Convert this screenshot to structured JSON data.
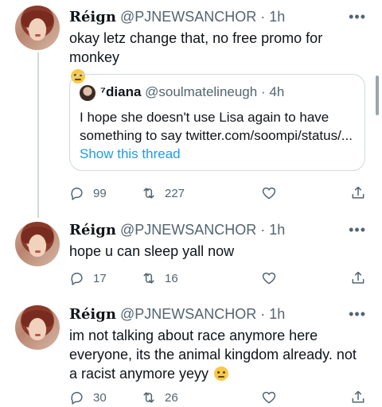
{
  "tweets": [
    {
      "name": "Réign",
      "handle": "@PJNEWSANCHOR",
      "dot": "·",
      "time": "1h",
      "more": "•••",
      "text": "okay letz change that, no free promo for monkey",
      "emoji": "frowning-face",
      "quote": {
        "name": "⁷diana",
        "handle": "@soulmatelineugh",
        "dot": "·",
        "time": "4h",
        "text": "I hope she doesn't use Lisa again to have something to say twitter.com/soompi/status/...",
        "show_thread": "Show this thread"
      },
      "replies": "99",
      "retweets": "227",
      "likes": ""
    },
    {
      "name": "Réign",
      "handle": "@PJNEWSANCHOR",
      "dot": "·",
      "time": "1h",
      "more": "•••",
      "text": "hope u can sleep yall now",
      "replies": "17",
      "retweets": "16",
      "likes": ""
    },
    {
      "name": "Réign",
      "handle": "@PJNEWSANCHOR",
      "dot": "·",
      "time": "1h",
      "more": "•••",
      "text": "im not talking about race anymore here everyone, its the animal kingdom already. not a racist anymore yeyy",
      "emoji": "frowning-face",
      "replies": "30",
      "retweets": "26",
      "likes": ""
    }
  ],
  "colors": {
    "text": "#0f1419",
    "secondary": "#536471",
    "link": "#1d9bf0",
    "border": "#cfd9de"
  }
}
